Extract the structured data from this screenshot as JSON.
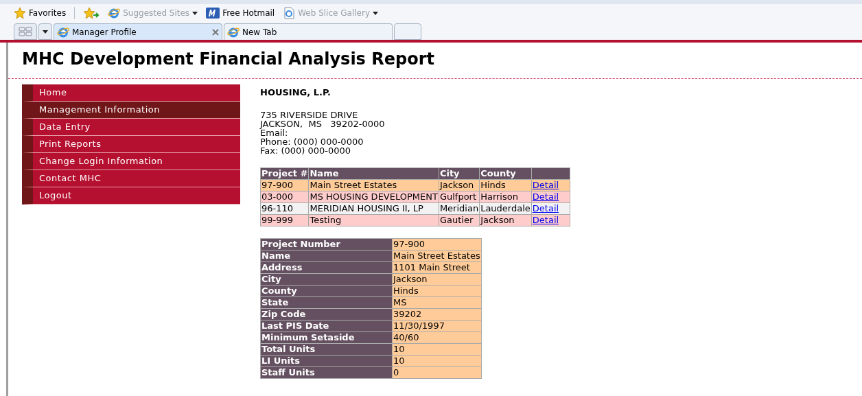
{
  "favorites_bar": {
    "favorites": "Favorites",
    "links": [
      {
        "label": "Suggested Sites",
        "kind": "suggested",
        "dimmed": true,
        "dropdown": true
      },
      {
        "label": "Free Hotmail",
        "kind": "hotmail",
        "dimmed": false,
        "dropdown": false
      },
      {
        "label": "Web Slice Gallery",
        "kind": "slice",
        "dimmed": true,
        "dropdown": true
      }
    ]
  },
  "tabs": [
    {
      "label": "Manager Profile",
      "selected": true
    },
    {
      "label": "New Tab",
      "selected": false
    }
  ],
  "page": {
    "title": "MHC Development Financial Analysis Report",
    "menu": [
      {
        "label": "Home",
        "selected": false
      },
      {
        "label": "Management Information",
        "selected": true
      },
      {
        "label": "Data Entry",
        "selected": false
      },
      {
        "label": "Print Reports",
        "selected": false
      },
      {
        "label": "Change Login Information",
        "selected": false
      },
      {
        "label": "Contact MHC",
        "selected": false
      },
      {
        "label": "Logout",
        "selected": false
      }
    ],
    "company": {
      "name": "HOUSING, L.P.",
      "lines": [
        "735 RIVERSIDE DRIVE",
        "JACKSON,  MS   39202-0000",
        "Email:",
        "Phone: (000) 000-0000",
        "Fax: (000) 000-0000"
      ]
    },
    "projects": {
      "columns": [
        "Project #",
        "Name",
        "City",
        "County"
      ],
      "rows": [
        {
          "cells": [
            "97-900",
            "Main Street Estates",
            "Jackson",
            "Hinds"
          ],
          "link": "Detail",
          "selected": true
        },
        {
          "cells": [
            "03-000",
            "MS HOUSING DEVELOPMENT",
            "Gulfport",
            "Harrison"
          ],
          "link": "Detail",
          "selected": false
        },
        {
          "cells": [
            "96-110",
            "MERIDIAN HOUSING II, LP",
            "Meridian",
            "Lauderdale"
          ],
          "link": "Detail",
          "selected": false
        },
        {
          "cells": [
            "99-999",
            "Testing",
            "Gautier",
            "Jackson"
          ],
          "link": "Detail",
          "selected": false
        }
      ]
    },
    "details": [
      {
        "label": "Project Number",
        "value": "97-900"
      },
      {
        "label": "Name",
        "value": "Main Street Estates"
      },
      {
        "label": "Address",
        "value": "1101 Main Street"
      },
      {
        "label": "City",
        "value": "Jackson"
      },
      {
        "label": "County",
        "value": "Hinds"
      },
      {
        "label": "State",
        "value": "MS"
      },
      {
        "label": "Zip Code",
        "value": "39202"
      },
      {
        "label": "Last PIS Date",
        "value": "11/30/1997"
      },
      {
        "label": "Minimum Setaside",
        "value": "40/60"
      },
      {
        "label": "Total Units",
        "value": "10"
      },
      {
        "label": "LI Units",
        "value": "10"
      },
      {
        "label": "Staff Units",
        "value": "0"
      }
    ]
  }
}
